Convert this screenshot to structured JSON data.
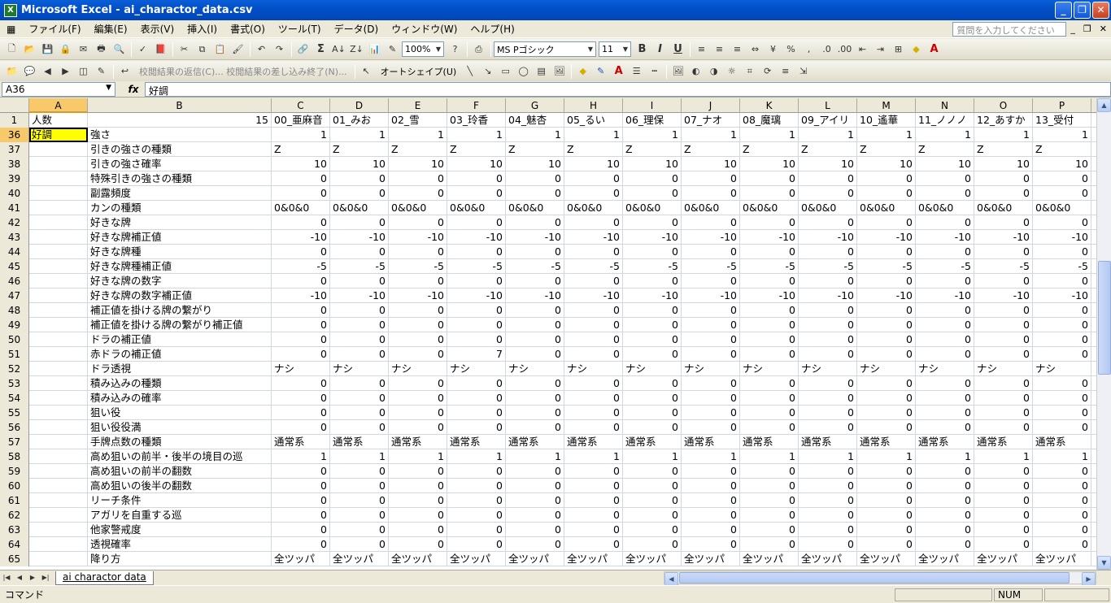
{
  "window": {
    "title": "Microsoft Excel - ai_charactor_data.csv",
    "app_icon": "X",
    "minimize": "_",
    "restore": "❐",
    "close": "✕"
  },
  "menu": {
    "items": [
      "ファイル(F)",
      "編集(E)",
      "表示(V)",
      "挿入(I)",
      "書式(O)",
      "ツール(T)",
      "データ(D)",
      "ウィンドウ(W)",
      "ヘルプ(H)"
    ],
    "help_placeholder": "質問を入力してください"
  },
  "toolbar1": {
    "zoom": "100%",
    "font_name": "MS Pゴシック",
    "font_size": "11"
  },
  "toolbar2": {
    "review_text": "校閲結果の返信(C)... 校閲結果の差し込み終了(N)...",
    "autoshape": "オートシェイプ(U)"
  },
  "formula_bar": {
    "name_box": "A36",
    "fx": "fx",
    "content": "好調"
  },
  "columns": [
    "A",
    "B",
    "C",
    "D",
    "E",
    "F",
    "G",
    "H",
    "I",
    "J",
    "K",
    "L",
    "M",
    "N",
    "O",
    "P"
  ],
  "rows": [
    {
      "n": "1",
      "a": "人数",
      "b": "",
      "c": [
        "00_亜麻音",
        "01_みお",
        "02_雪",
        "03_玲香",
        "04_魅杏",
        "05_るい",
        "06_理保",
        "07_ナオ",
        "08_魔璃",
        "09_アイリ",
        "10_遙華",
        "11_ノノノ",
        "12_あすか",
        "13_受付"
      ],
      "b_num": "15",
      "text": true
    },
    {
      "n": "36",
      "a": "好調",
      "b": "強さ",
      "c": [
        "1",
        "1",
        "1",
        "1",
        "1",
        "1",
        "1",
        "1",
        "1",
        "1",
        "1",
        "1",
        "1",
        "1"
      ]
    },
    {
      "n": "37",
      "a": "",
      "b": "引きの強さの種類",
      "c": [
        "Z",
        "Z",
        "Z",
        "Z",
        "Z",
        "Z",
        "Z",
        "Z",
        "Z",
        "Z",
        "Z",
        "Z",
        "Z",
        "Z"
      ],
      "text": true
    },
    {
      "n": "38",
      "a": "",
      "b": "引きの強さ確率",
      "c": [
        "10",
        "10",
        "10",
        "10",
        "10",
        "10",
        "10",
        "10",
        "10",
        "10",
        "10",
        "10",
        "10",
        "10"
      ]
    },
    {
      "n": "39",
      "a": "",
      "b": "特殊引きの強さの種類",
      "c": [
        "0",
        "0",
        "0",
        "0",
        "0",
        "0",
        "0",
        "0",
        "0",
        "0",
        "0",
        "0",
        "0",
        "0"
      ]
    },
    {
      "n": "40",
      "a": "",
      "b": "副露頻度",
      "c": [
        "0",
        "0",
        "0",
        "0",
        "0",
        "0",
        "0",
        "0",
        "0",
        "0",
        "0",
        "0",
        "0",
        "0"
      ]
    },
    {
      "n": "41",
      "a": "",
      "b": "カンの種類",
      "c": [
        "0&0&0",
        "0&0&0",
        "0&0&0",
        "0&0&0",
        "0&0&0",
        "0&0&0",
        "0&0&0",
        "0&0&0",
        "0&0&0",
        "0&0&0",
        "0&0&0",
        "0&0&0",
        "0&0&0",
        "0&0&0"
      ],
      "text": true
    },
    {
      "n": "42",
      "a": "",
      "b": "好きな牌",
      "c": [
        "0",
        "0",
        "0",
        "0",
        "0",
        "0",
        "0",
        "0",
        "0",
        "0",
        "0",
        "0",
        "0",
        "0"
      ]
    },
    {
      "n": "43",
      "a": "",
      "b": "好きな牌補正値",
      "c": [
        "-10",
        "-10",
        "-10",
        "-10",
        "-10",
        "-10",
        "-10",
        "-10",
        "-10",
        "-10",
        "-10",
        "-10",
        "-10",
        "-10"
      ]
    },
    {
      "n": "44",
      "a": "",
      "b": "好きな牌種",
      "c": [
        "0",
        "0",
        "0",
        "0",
        "0",
        "0",
        "0",
        "0",
        "0",
        "0",
        "0",
        "0",
        "0",
        "0"
      ]
    },
    {
      "n": "45",
      "a": "",
      "b": "好きな牌種補正値",
      "c": [
        "-5",
        "-5",
        "-5",
        "-5",
        "-5",
        "-5",
        "-5",
        "-5",
        "-5",
        "-5",
        "-5",
        "-5",
        "-5",
        "-5"
      ]
    },
    {
      "n": "46",
      "a": "",
      "b": "好きな牌の数字",
      "c": [
        "0",
        "0",
        "0",
        "0",
        "0",
        "0",
        "0",
        "0",
        "0",
        "0",
        "0",
        "0",
        "0",
        "0"
      ]
    },
    {
      "n": "47",
      "a": "",
      "b": "好きな牌の数字補正値",
      "c": [
        "-10",
        "-10",
        "-10",
        "-10",
        "-10",
        "-10",
        "-10",
        "-10",
        "-10",
        "-10",
        "-10",
        "-10",
        "-10",
        "-10"
      ]
    },
    {
      "n": "48",
      "a": "",
      "b": "補正値を掛ける牌の繋がり",
      "c": [
        "0",
        "0",
        "0",
        "0",
        "0",
        "0",
        "0",
        "0",
        "0",
        "0",
        "0",
        "0",
        "0",
        "0"
      ]
    },
    {
      "n": "49",
      "a": "",
      "b": "補正値を掛ける牌の繋がり補正値",
      "c": [
        "0",
        "0",
        "0",
        "0",
        "0",
        "0",
        "0",
        "0",
        "0",
        "0",
        "0",
        "0",
        "0",
        "0"
      ]
    },
    {
      "n": "50",
      "a": "",
      "b": "ドラの補正値",
      "c": [
        "0",
        "0",
        "0",
        "0",
        "0",
        "0",
        "0",
        "0",
        "0",
        "0",
        "0",
        "0",
        "0",
        "0"
      ]
    },
    {
      "n": "51",
      "a": "",
      "b": "赤ドラの補正値",
      "c": [
        "0",
        "0",
        "0",
        "7",
        "0",
        "0",
        "0",
        "0",
        "0",
        "0",
        "0",
        "0",
        "0",
        "0"
      ]
    },
    {
      "n": "52",
      "a": "",
      "b": "ドラ透視",
      "c": [
        "ナシ",
        "ナシ",
        "ナシ",
        "ナシ",
        "ナシ",
        "ナシ",
        "ナシ",
        "ナシ",
        "ナシ",
        "ナシ",
        "ナシ",
        "ナシ",
        "ナシ",
        "ナシ"
      ],
      "text": true
    },
    {
      "n": "53",
      "a": "",
      "b": "積み込みの種類",
      "c": [
        "0",
        "0",
        "0",
        "0",
        "0",
        "0",
        "0",
        "0",
        "0",
        "0",
        "0",
        "0",
        "0",
        "0"
      ]
    },
    {
      "n": "54",
      "a": "",
      "b": "積み込みの確率",
      "c": [
        "0",
        "0",
        "0",
        "0",
        "0",
        "0",
        "0",
        "0",
        "0",
        "0",
        "0",
        "0",
        "0",
        "0"
      ]
    },
    {
      "n": "55",
      "a": "",
      "b": "狙い役",
      "c": [
        "0",
        "0",
        "0",
        "0",
        "0",
        "0",
        "0",
        "0",
        "0",
        "0",
        "0",
        "0",
        "0",
        "0"
      ]
    },
    {
      "n": "56",
      "a": "",
      "b": "狙い役役満",
      "c": [
        "0",
        "0",
        "0",
        "0",
        "0",
        "0",
        "0",
        "0",
        "0",
        "0",
        "0",
        "0",
        "0",
        "0"
      ]
    },
    {
      "n": "57",
      "a": "",
      "b": "手牌点数の種類",
      "c": [
        "通常系",
        "通常系",
        "通常系",
        "通常系",
        "通常系",
        "通常系",
        "通常系",
        "通常系",
        "通常系",
        "通常系",
        "通常系",
        "通常系",
        "通常系",
        "通常系"
      ],
      "text": true
    },
    {
      "n": "58",
      "a": "",
      "b": "高め狙いの前半・後半の境目の巡",
      "c": [
        "1",
        "1",
        "1",
        "1",
        "1",
        "1",
        "1",
        "1",
        "1",
        "1",
        "1",
        "1",
        "1",
        "1"
      ]
    },
    {
      "n": "59",
      "a": "",
      "b": "高め狙いの前半の翻数",
      "c": [
        "0",
        "0",
        "0",
        "0",
        "0",
        "0",
        "0",
        "0",
        "0",
        "0",
        "0",
        "0",
        "0",
        "0"
      ]
    },
    {
      "n": "60",
      "a": "",
      "b": "高め狙いの後半の翻数",
      "c": [
        "0",
        "0",
        "0",
        "0",
        "0",
        "0",
        "0",
        "0",
        "0",
        "0",
        "0",
        "0",
        "0",
        "0"
      ]
    },
    {
      "n": "61",
      "a": "",
      "b": "リーチ条件",
      "c": [
        "0",
        "0",
        "0",
        "0",
        "0",
        "0",
        "0",
        "0",
        "0",
        "0",
        "0",
        "0",
        "0",
        "0"
      ]
    },
    {
      "n": "62",
      "a": "",
      "b": "アガリを自重する巡",
      "c": [
        "0",
        "0",
        "0",
        "0",
        "0",
        "0",
        "0",
        "0",
        "0",
        "0",
        "0",
        "0",
        "0",
        "0"
      ]
    },
    {
      "n": "63",
      "a": "",
      "b": "他家警戒度",
      "c": [
        "0",
        "0",
        "0",
        "0",
        "0",
        "0",
        "0",
        "0",
        "0",
        "0",
        "0",
        "0",
        "0",
        "0"
      ]
    },
    {
      "n": "64",
      "a": "",
      "b": "透視確率",
      "c": [
        "0",
        "0",
        "0",
        "0",
        "0",
        "0",
        "0",
        "0",
        "0",
        "0",
        "0",
        "0",
        "0",
        "0"
      ]
    },
    {
      "n": "65",
      "a": "",
      "b": "降り方",
      "c": [
        "全ツッパ",
        "全ツッパ",
        "全ツッパ",
        "全ツッパ",
        "全ツッパ",
        "全ツッパ",
        "全ツッパ",
        "全ツッパ",
        "全ツッパ",
        "全ツッパ",
        "全ツッパ",
        "全ツッパ",
        "全ツッパ",
        "全ツッパ"
      ],
      "text": true
    }
  ],
  "sheet_tab": "ai charactor data",
  "status": {
    "mode": "コマンド",
    "num": "NUM"
  }
}
